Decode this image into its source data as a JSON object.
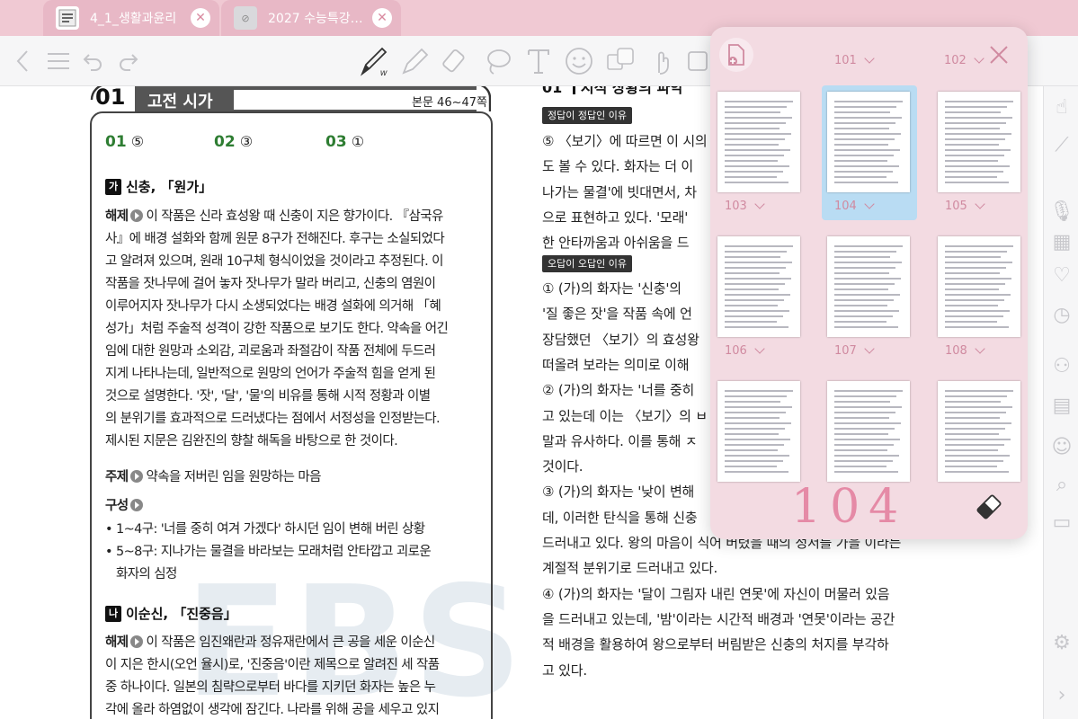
{
  "tabs": [
    {
      "title": "4_1_생활과윤리",
      "active": false
    },
    {
      "title": "2027 수능특강…",
      "active": true
    }
  ],
  "toolbar": {
    "tools": [
      "back-icon",
      "menu-icon",
      "undo-icon",
      "redo-icon",
      "pen-icon",
      "highlighter-icon",
      "eraser-icon",
      "lasso-icon",
      "text-icon",
      "sticker-icon",
      "translate-icon",
      "hand-icon",
      "image-icon",
      "pages-icon"
    ],
    "active_tool": "pen-icon"
  },
  "left_page": {
    "number": "01",
    "title": "고전 시가",
    "page_ref": "본문 46~47쪽",
    "answers": [
      {
        "num": "01",
        "val": "⑤"
      },
      {
        "num": "02",
        "val": "③"
      },
      {
        "num": "03",
        "val": "①"
      }
    ],
    "section_ga": {
      "badge": "가",
      "title": "신충, 「원가」"
    },
    "haeje_label": "해제",
    "haeje_ga": [
      "이 작품은 신라 효성왕 때 신충이 지은 향가이다. 『삼국유",
      "사』에 배경 설화와 함께 원문 8구가 전해진다. 후구는 소실되었다",
      "고 알려져 있으며, 원래 10구체 형식이었을 것이라고 추정된다. 이",
      "작품을 잣나무에 걸어 놓자 잣나무가 말라 버리고, 신충의 염원이",
      "이루어지자 잣나무가 다시 소생되었다는 배경 설화에 의거해 「혜",
      "성가」처럼 주술적 성격이 강한 작품으로 보기도 한다. 약속을 어긴",
      "임에 대한 원망과 소외감, 괴로움과 좌절감이 작품 전체에 두드러",
      "지게 나타나는데, 일반적으로 원망의 언어가 주술적 힘을 얻게 된",
      "것으로 설명한다. '잣', '달', '물'의 비유를 통해 시적 정황과 이별",
      "의 분위기를 효과적으로 드러냈다는 점에서 서정성을 인정받는다.",
      "제시된 지문은 김완진의 향찰 해독을 바탕으로 한 것이다."
    ],
    "juje_label": "주제",
    "juje": "약속을 저버린 임을 원망하는 마음",
    "gusung_label": "구성",
    "gusung": [
      "• 1~4구: '너를 중히 여겨 가겠다' 하시던 임이 변해 버린 상황",
      "• 5~8구: 지나가는 물결을 바라보는 모래처럼 안타깝고 괴로운",
      "   화자의 심정"
    ],
    "section_na": {
      "badge": "나",
      "title": "이순신, 「진중음」"
    },
    "haeje_na": [
      "이 작품은 임진왜란과 정유재란에서 큰 공을 세운 이순신",
      "이 지은 한시(오언 율시)로, '진중음'이란 제목으로 알려진 세 작품",
      "중 하나이다. 일본의 침략으로부터 바다를 지키던 화자는 높은 누",
      "각에 올라 하염없이 생각에 잠긴다. 나라를 위해 공을 세우고 있지"
    ]
  },
  "right_page": {
    "heading_num": "01",
    "heading": "시적 상황의 파악",
    "tag_correct": "정답이 정답인 이유",
    "correct_lines": [
      "⑤ 〈보기〉에 따르면 이 시의",
      "도 볼 수 있다. 화자는 더 이",
      "나가는 물결'에 빗대면서, 차",
      "으로 표현하고 있다. '모래'",
      "한 안타까움과 아쉬움을 드"
    ],
    "tag_wrong": "오답이 오답인 이유",
    "wrong_lines": [
      "① (가)의 화자는 '신충'의",
      "'질 좋은 잣'을 작품 속에 언",
      "장담했던 〈보기〉의 효성왕",
      "떠올려 보라는 의미로 이해",
      "② (가)의 화자는 '너를 중히",
      "고 있는데 이는 〈보기〉의 ㅂ",
      "말과 유사하다. 이를 통해 ㅈ",
      "것이다.",
      "③ (가)의 화자는 '낮이 변해",
      "데, 이러한 탄식을 통해 신충",
      "드러내고 있다. 왕의 마음이 식어 버렸을 때의 정서를 가을 이라는",
      "계절적 분위기로 드러내고 있다.",
      "④ (가)의 화자는 '달이 그림자 내린 연못'에 자신이 머물러 있음",
      "을 드러내고 있는데, '밤'이라는 시간적 배경과 '연못'이라는 공간",
      "적 배경을 활용하여 왕으로부터 버림받은 신충의 처지를 부각하",
      "고 있다."
    ]
  },
  "popover": {
    "top_labels": [
      "101",
      "102"
    ],
    "pages": [
      {
        "label": "103",
        "selected": false
      },
      {
        "label": "104",
        "selected": true
      },
      {
        "label": "105",
        "selected": false
      },
      {
        "label": "106",
        "selected": false
      },
      {
        "label": "107",
        "selected": false
      },
      {
        "label": "108",
        "selected": false
      },
      {
        "label": "",
        "selected": false
      },
      {
        "label": "",
        "selected": false
      },
      {
        "label": "",
        "selected": false
      }
    ],
    "handwritten": "104",
    "add_icon": "add-page-icon",
    "close_icon": "close-icon",
    "eraser_icon": "eraser-icon"
  },
  "sidebar": {
    "icons": [
      "pages-icon",
      "hand-icon",
      "ruler-icon",
      "microphone-icon",
      "calculator-icon",
      "bookmark-heart-icon",
      "timer-icon",
      "share-icon",
      "document-icon",
      "robot-icon",
      "search-icon",
      "presentation-icon",
      "settings-icon",
      "chevron-right-icon"
    ]
  },
  "colors": {
    "tab_bar": "#f0c9d3",
    "accent_pink": "#d98aa0",
    "selection_blue": "#b9dcf3",
    "answer_green": "#2e7d32"
  }
}
